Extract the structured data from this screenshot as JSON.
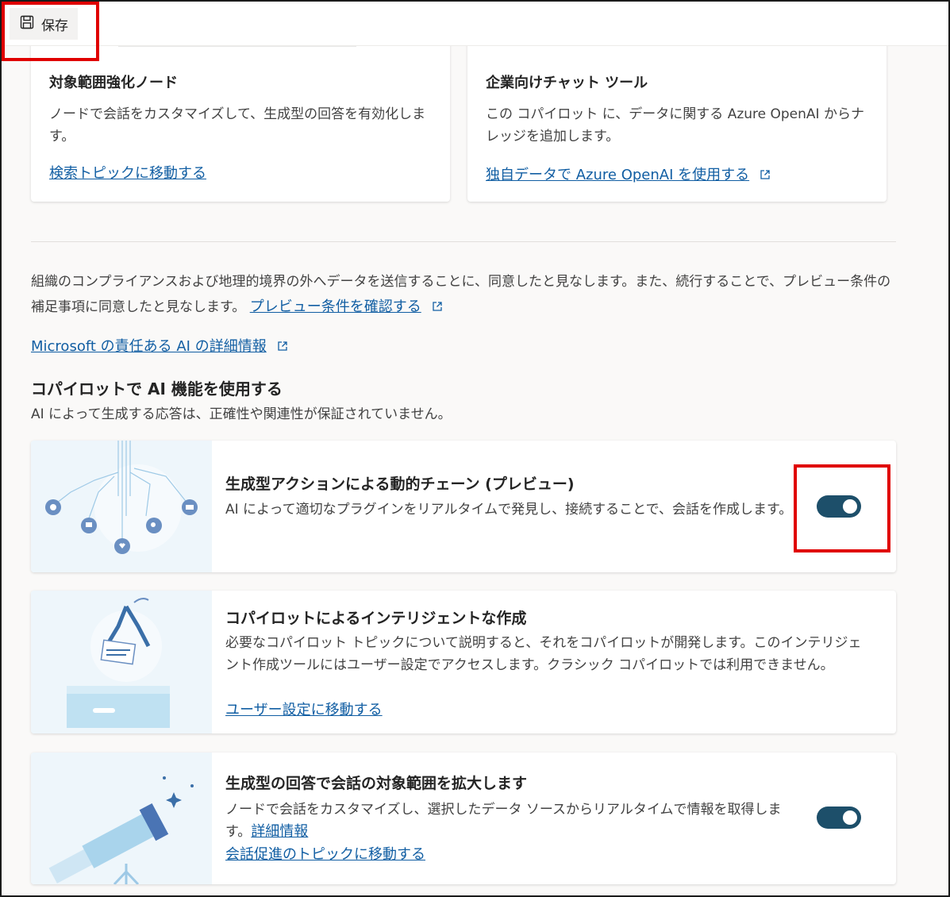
{
  "toolbar": {
    "save_label": "保存"
  },
  "cards": [
    {
      "title": "対象範囲強化ノード",
      "desc": "ノードで会話をカスタマイズして、生成型の回答を有効化します。",
      "link": "検索トピックに移動する"
    },
    {
      "title": "企業向けチャット ツール",
      "desc": "この コパイロット に、データに関する Azure OpenAI からナレッジを追加します。",
      "link": "独自データで Azure OpenAI を使用する"
    }
  ],
  "consent": {
    "text": "組織のコンプライアンスおよび地理的境界の外へデータを送信することに、同意したと見なします。また、続行することで、プレビュー条件の補足事項に同意したと見なします。",
    "link": "プレビュー条件を確認する"
  },
  "ms_link": "Microsoft の責任ある AI の詳細情報",
  "section": {
    "title": "コパイロットで AI 機能を使用する",
    "subtitle": "AI によって生成する応答は、正確性や関連性が保証されていません。"
  },
  "features": [
    {
      "title": "生成型アクションによる動的チェーン (プレビュー)",
      "desc": "AI によって適切なプラグインをリアルタイムで発見し、接続することで、会話を作成します。",
      "toggle_on": true
    },
    {
      "title": "コパイロットによるインテリジェントな作成",
      "desc": "必要なコパイロット トピックについて説明すると、それをコパイロットが開発します。このインテリジェント作成ツールにはユーザー設定でアクセスします。クラシック コパイロットでは利用できません。",
      "link": "ユーザー設定に移動する"
    },
    {
      "title": "生成型の回答で会話の対象範囲を拡大します",
      "desc": "ノードで会話をカスタマイズし、選択したデータ ソースからリアルタイムで情報を取得します。",
      "inline_link": "詳細情報",
      "link": "会話促進のトピックに移動する",
      "toggle_on": true
    }
  ]
}
